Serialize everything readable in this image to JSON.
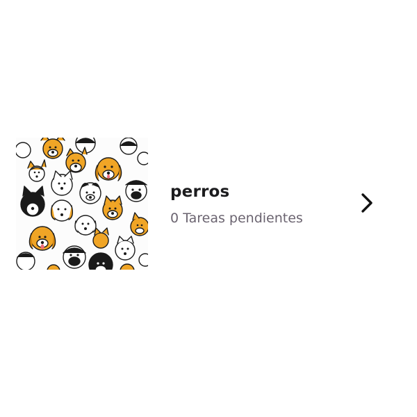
{
  "list": {
    "title": "perros",
    "pending_count": 0,
    "subtitle": "0 Tareas pendientes",
    "thumbnail_icon": "dog-faces-pattern",
    "navigate_icon": "chevron-right-icon"
  },
  "colors": {
    "background": "#ffffff",
    "title": "#1c1c1e",
    "subtitle": "#6b6470",
    "accent_orange": "#f0a526",
    "chevron": "#111111"
  }
}
